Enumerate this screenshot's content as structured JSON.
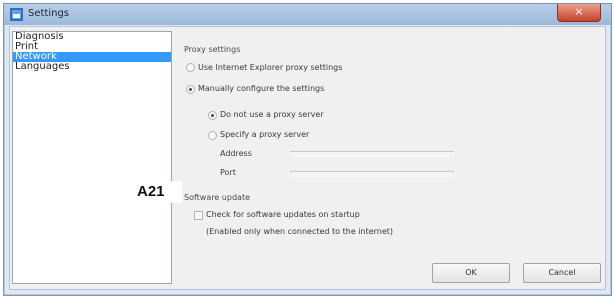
{
  "window": {
    "title": "Settings",
    "close_glyph": "×"
  },
  "sidebar": {
    "items": [
      {
        "label": "Diagnosis"
      },
      {
        "label": "Print"
      },
      {
        "label": "Network",
        "selected": true
      },
      {
        "label": "Languages"
      }
    ]
  },
  "proxy": {
    "section_title": "Proxy settings",
    "use_ie_label": "Use Internet Explorer proxy settings",
    "manual_label": "Manually configure the settings",
    "no_proxy_label": "Do not use a proxy server",
    "specify_label": "Specify a proxy server",
    "address_label": "Address",
    "port_label": "Port",
    "address_value": "",
    "port_value": "",
    "selected_mode": "manual",
    "manual_option": "no_proxy"
  },
  "software_update": {
    "section_title": "Software update",
    "check_label": "Check for software updates on startup",
    "note": "(Enabled only when connected to the internet)",
    "checked": false
  },
  "buttons": {
    "ok_label": "OK",
    "cancel_label": "Cancel"
  },
  "annotation": {
    "callout_label": "A21"
  },
  "colors": {
    "title_gradient_top": "#b9cee8",
    "selection": "#3399ff",
    "close_red": "#c7432b"
  }
}
